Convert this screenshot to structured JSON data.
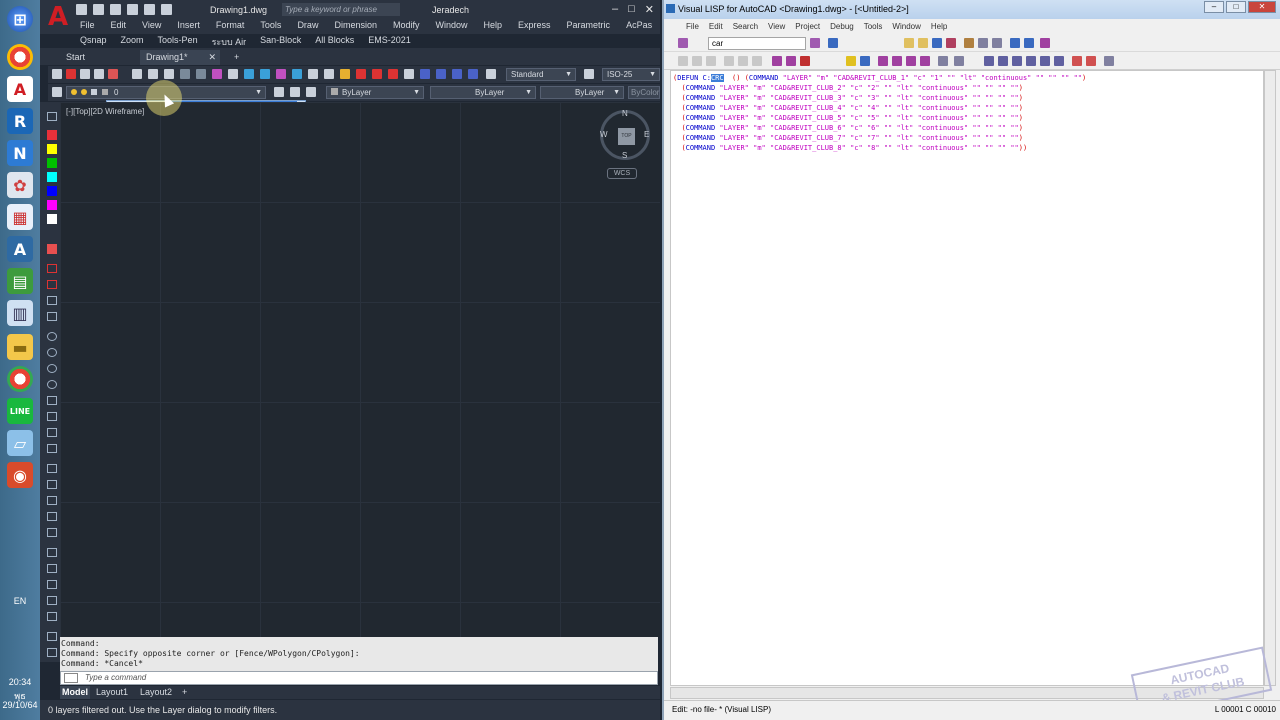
{
  "taskbar": {
    "apps": [
      "chrome-icon",
      "autocad-icon",
      "revit-icon",
      "navisworks-icon",
      "paint-icon",
      "calendar-icon",
      "acrobat-icon",
      "calculator-icon",
      "notepad-icon",
      "explorer-icon",
      "chrome-icon",
      "line-icon",
      "book-icon",
      "powerpoint-icon"
    ],
    "lang": "EN",
    "time": "20:34",
    "weekday": "พุธ",
    "date": "29/10/64"
  },
  "acad": {
    "doc_title": "Drawing1.dwg",
    "search_placeholder": "Type a keyword or phrase",
    "user": "Jeradech",
    "menu": [
      "File",
      "Edit",
      "View",
      "Insert",
      "Format",
      "Tools",
      "Draw",
      "Dimension",
      "Modify",
      "Window",
      "Help",
      "Express",
      "Parametric",
      "AcPas"
    ],
    "menu2": [
      "Qsnap",
      "Zoom",
      "Tools-Pen",
      "ระบบ Air",
      "San-Block",
      "All Blocks",
      "EMS-2021"
    ],
    "tabs": [
      "Start",
      "Drawing1*"
    ],
    "text_style": "Standard",
    "dim_style": "ISO-25",
    "layer": "0",
    "color": "ByLayer",
    "linetype": "ByLayer",
    "lineweight": "ByLayer",
    "plotstyle": "ByColor",
    "viewport_label": "[-][Top][2D Wireframe]",
    "viewcube": {
      "top": "TOP",
      "n": "N",
      "s": "S",
      "e": "E",
      "w": "W",
      "wcs": "WCS"
    },
    "command_history": [
      "Command:",
      "Command: Specify opposite corner or [Fence/WPolygon/CPolygon]:",
      "Command: *Cancel*"
    ],
    "command_placeholder": "Type a command",
    "layout_tabs": [
      "Model",
      "Layout1",
      "Layout2"
    ],
    "status": "0 layers filtered out.  Use the Layer dialog to modify filters.",
    "palette_colors": [
      "#e8303a",
      "#ffff00",
      "#00c000",
      "#00ffff",
      "#0000ff",
      "#ff00ff",
      "#ffffff"
    ]
  },
  "vlisp": {
    "title": "Visual LISP for AutoCAD <Drawing1.dwg> - [<Untitled-2>]",
    "menu": [
      "File",
      "Edit",
      "Search",
      "View",
      "Project",
      "Debug",
      "Tools",
      "Window",
      "Help"
    ],
    "search_value": "car",
    "code_lines": [
      {
        "lead": "(DEFUN C:",
        "sel": "CRC",
        "rest": "  () (COMMAND \"LAYER\" \"m\" \"CAD&REVIT_CLUB_1\" \"c\" \"1\" \"\" \"lt\" \"continuous\" \"\" \"\" \"\" \"\")"
      },
      {
        "lead": "  (COMMAND \"LAYER\" \"m\" \"CAD&REVIT_CLUB_2\" \"c\" \"2\" \"\" \"lt\" \"continuous\" \"\" \"\" \"\" \"\")",
        "sel": "",
        "rest": ""
      },
      {
        "lead": "  (COMMAND \"LAYER\" \"m\" \"CAD&REVIT_CLUB_3\" \"c\" \"3\" \"\" \"lt\" \"continuous\" \"\" \"\" \"\" \"\")",
        "sel": "",
        "rest": ""
      },
      {
        "lead": "  (COMMAND \"LAYER\" \"m\" \"CAD&REVIT_CLUB_4\" \"c\" \"4\" \"\" \"lt\" \"continuous\" \"\" \"\" \"\" \"\")",
        "sel": "",
        "rest": ""
      },
      {
        "lead": "  (COMMAND \"LAYER\" \"m\" \"CAD&REVIT_CLUB_5\" \"c\" \"5\" \"\" \"lt\" \"continuous\" \"\" \"\" \"\" \"\")",
        "sel": "",
        "rest": ""
      },
      {
        "lead": "  (COMMAND \"LAYER\" \"m\" \"CAD&REVIT_CLUB_6\" \"c\" \"6\" \"\" \"lt\" \"continuous\" \"\" \"\" \"\" \"\")",
        "sel": "",
        "rest": ""
      },
      {
        "lead": "  (COMMAND \"LAYER\" \"m\" \"CAD&REVIT_CLUB_7\" \"c\" \"7\" \"\" \"lt\" \"continuous\" \"\" \"\" \"\" \"\")",
        "sel": "",
        "rest": ""
      },
      {
        "lead": "  (COMMAND \"LAYER\" \"m\" \"CAD&REVIT_CLUB_8\" \"c\" \"8\" \"\" \"lt\" \"continuous\" \"\" \"\" \"\" \"\"))",
        "sel": "",
        "rest": ""
      }
    ],
    "status_left": "Edit: -no file- *  (Visual LISP)",
    "status_right": "L 00001  C 00010",
    "watermark": "AUTOCAD & REVIT CLUB"
  }
}
